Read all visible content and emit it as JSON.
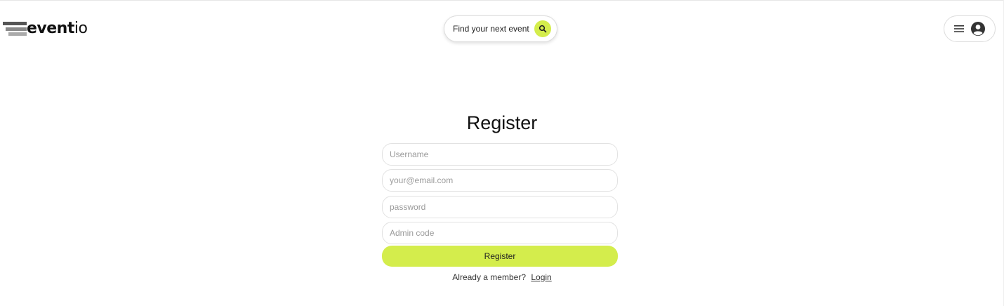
{
  "brand": {
    "logo_bold": "event",
    "logo_light": "io",
    "accent_color": "#d4ed4c"
  },
  "header": {
    "search_label": "Find your next event",
    "search_icon": "search-icon",
    "menu_icon": "hamburger-menu-icon",
    "profile_icon": "user-circle-icon"
  },
  "form": {
    "title": "Register",
    "username_placeholder": "Username",
    "email_placeholder": "your@email.com",
    "password_placeholder": "password",
    "admin_code_placeholder": "Admin code",
    "submit_label": "Register",
    "member_prompt": "Already a member?",
    "login_link": "Login"
  }
}
